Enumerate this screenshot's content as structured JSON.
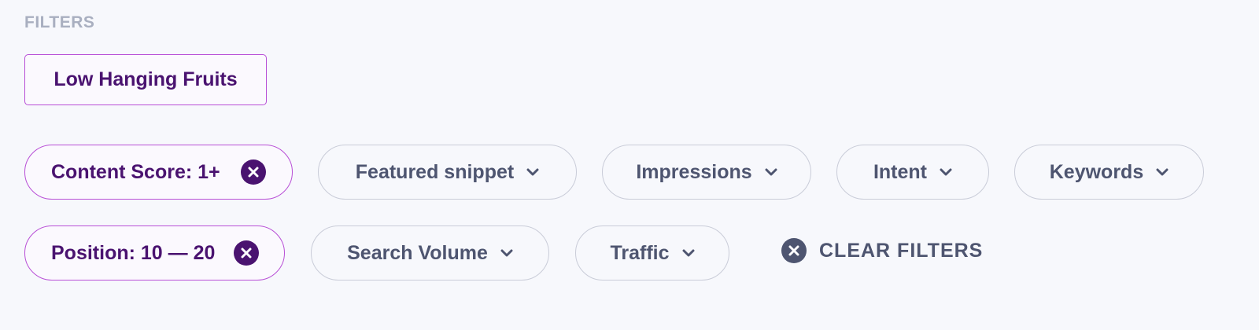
{
  "filters": {
    "title": "FILTERS",
    "preset": "Low Hanging Fruits",
    "row1": {
      "content_score": "Content Score: 1+",
      "featured_snippet": "Featured snippet",
      "impressions": "Impressions",
      "intent": "Intent",
      "keywords": "Keywords"
    },
    "row2": {
      "position": "Position: 10 — 20",
      "search_volume": "Search Volume",
      "traffic": "Traffic"
    },
    "clear_label": "CLEAR FILTERS"
  },
  "colors": {
    "active_border": "#b84fd6",
    "active_text": "#4a1370",
    "inactive_border": "#c9ccd8",
    "inactive_text": "#4e5570",
    "background": "#f7f8fc",
    "title": "#a9afc0"
  },
  "icons": {
    "remove": "x-circle-icon",
    "dropdown": "chevron-down-icon",
    "clear": "x-circle-icon"
  }
}
